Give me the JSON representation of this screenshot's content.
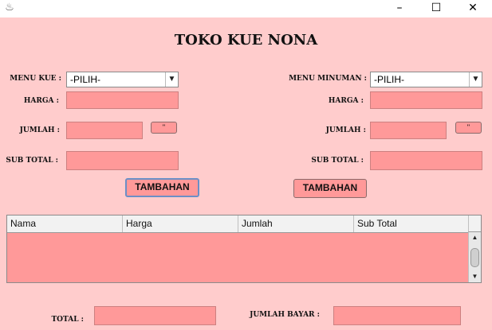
{
  "window": {
    "app_icon": "java-coffee-icon",
    "minimize_glyph": "–",
    "maximize_glyph": "☐",
    "close_glyph": "✕"
  },
  "title": "TOKO KUE NONA",
  "left": {
    "menu_label": "MENU KUE :",
    "menu_value": "-PILIH-",
    "harga_label": "HARGA :",
    "harga_value": "",
    "jumlah_label": "JUMLAH :",
    "jumlah_value": "",
    "jumlah_btn": "\"",
    "subtotal_label": "SUB TOTAL :",
    "subtotal_value": "",
    "add_button": "TAMBAHAN"
  },
  "right": {
    "menu_label": "MENU MINUMAN :",
    "menu_value": "-PILIH-",
    "harga_label": "HARGA :",
    "harga_value": "",
    "jumlah_label": "JUMLAH :",
    "jumlah_value": "",
    "jumlah_btn": "\"",
    "subtotal_label": "SUB TOTAL :",
    "subtotal_value": "",
    "add_button": "TAMBAHAN"
  },
  "table": {
    "columns": [
      "Nama",
      "Harga",
      "Jumlah",
      "Sub Total"
    ],
    "rows": []
  },
  "footer": {
    "total_label": "TOTAL :",
    "total_value": "",
    "bayar_label": "JUMLAH BAYAR :",
    "bayar_value": ""
  },
  "colors": {
    "background": "#ffcccc",
    "field": "#ff9999"
  }
}
